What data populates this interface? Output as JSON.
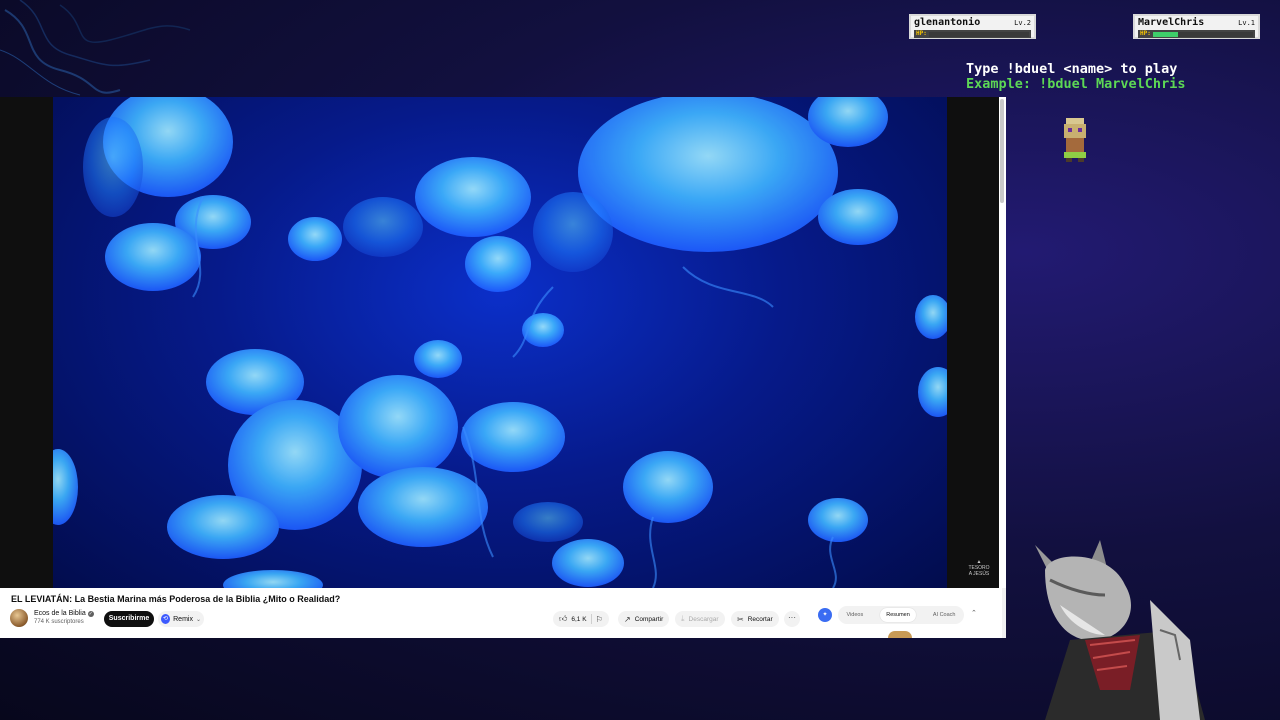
{
  "overlay": {
    "players": [
      {
        "name": "glenantonio",
        "level": "Lv.2",
        "hp_label": "HP:",
        "hp_fraction": 0.0
      },
      {
        "name": "MarvelChris",
        "level": "Lv.1",
        "hp_label": "HP:",
        "hp_fraction": 0.25
      }
    ],
    "instructions": {
      "line1": "Type !bduel <name> to play",
      "line2": "Example: !bduel MarvelChris"
    },
    "colors": {
      "instruction": "#ffffff",
      "example": "#5dd855",
      "hp_fill": "#3ecf6a"
    }
  },
  "youtube": {
    "video_title": "EL LEVIATÁN: La Bestia Marina más Poderosa de la Biblia ¿Mito o Realidad?",
    "channel": {
      "name": "Ecos de la Biblia",
      "subscribers": "774 K suscriptores"
    },
    "subscribe_label": "Suscribirme",
    "remix_label": "Remix",
    "likes": "6,1 K",
    "share_label": "Compartir",
    "download_label": "Descargar",
    "clip_label": "Recortar",
    "more_label": "···",
    "tabs": [
      "Videos",
      "Resumen",
      "AI Coach"
    ],
    "active_tab": "Resumen",
    "watermark": "TESORO A JESÚS"
  }
}
